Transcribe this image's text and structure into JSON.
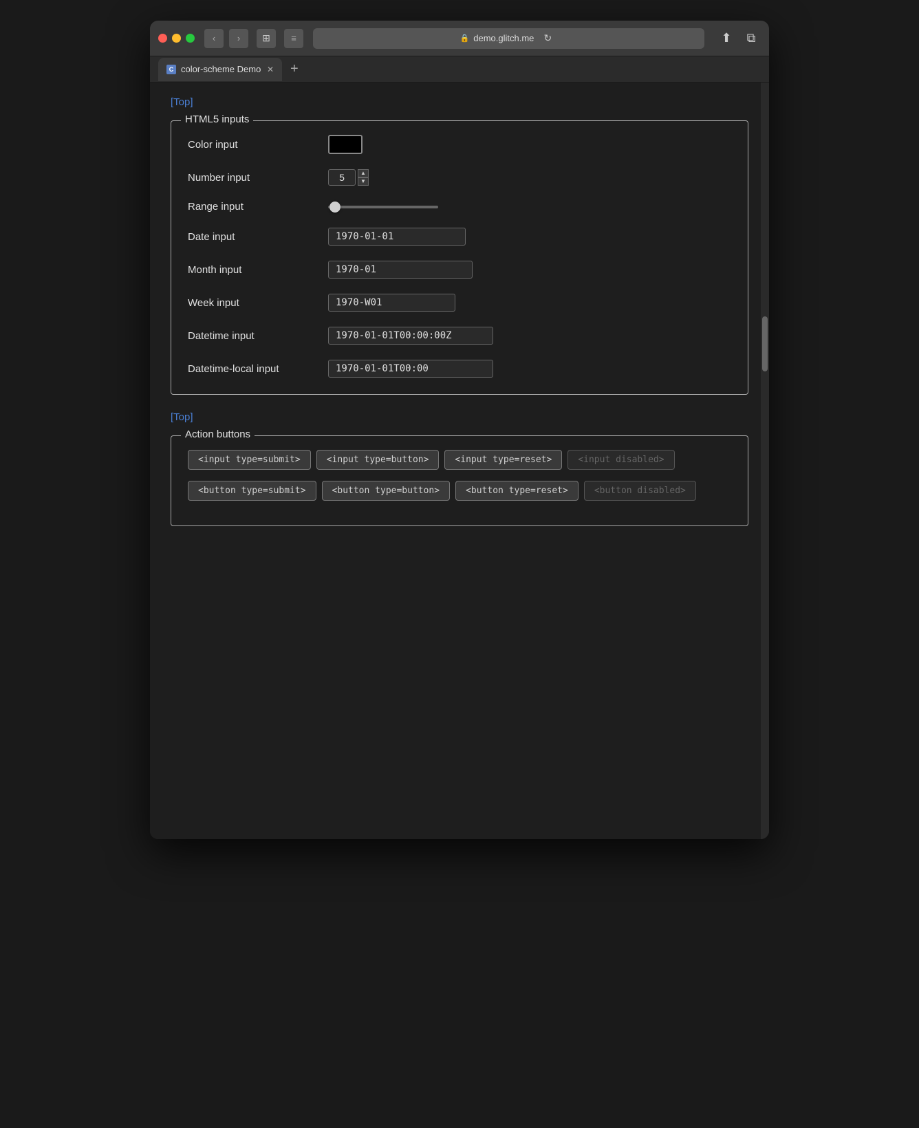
{
  "browser": {
    "url": "demo.glitch.me",
    "tab_title": "color-scheme Demo",
    "tab_favicon": "C",
    "back_label": "‹",
    "forward_label": "›",
    "sidebar_label": "⊞",
    "menu_label": "≡",
    "reload_label": "↻",
    "share_label": "⬆",
    "newwindow_label": "⧉",
    "newtab_label": "+"
  },
  "page": {
    "top_link": "[Top]",
    "top_link2": "[Top]",
    "html5_section_title": "HTML5 inputs",
    "action_section_title": "Action buttons",
    "inputs": {
      "color_label": "Color input",
      "color_value": "#000000",
      "number_label": "Number input",
      "number_value": "5",
      "range_label": "Range input",
      "date_label": "Date input",
      "date_value": "1970-01-01",
      "month_label": "Month input",
      "month_value": "1970-01",
      "week_label": "Week input",
      "week_value": "1970-W01",
      "datetime_label": "Datetime input",
      "datetime_value": "1970-01-01T00:00:00Z",
      "datetimelocal_label": "Datetime-local input",
      "datetimelocal_value": "1970-01-01T00:00"
    },
    "action_buttons": {
      "input_submit": "<input type=submit>",
      "input_button": "<input type=button>",
      "input_reset": "<input type=reset>",
      "input_disabled": "<input disabled>",
      "button_submit": "<button type=submit>",
      "button_button": "<button type=button>",
      "button_reset": "<button type=reset>",
      "button_disabled": "<button disabled>"
    }
  }
}
